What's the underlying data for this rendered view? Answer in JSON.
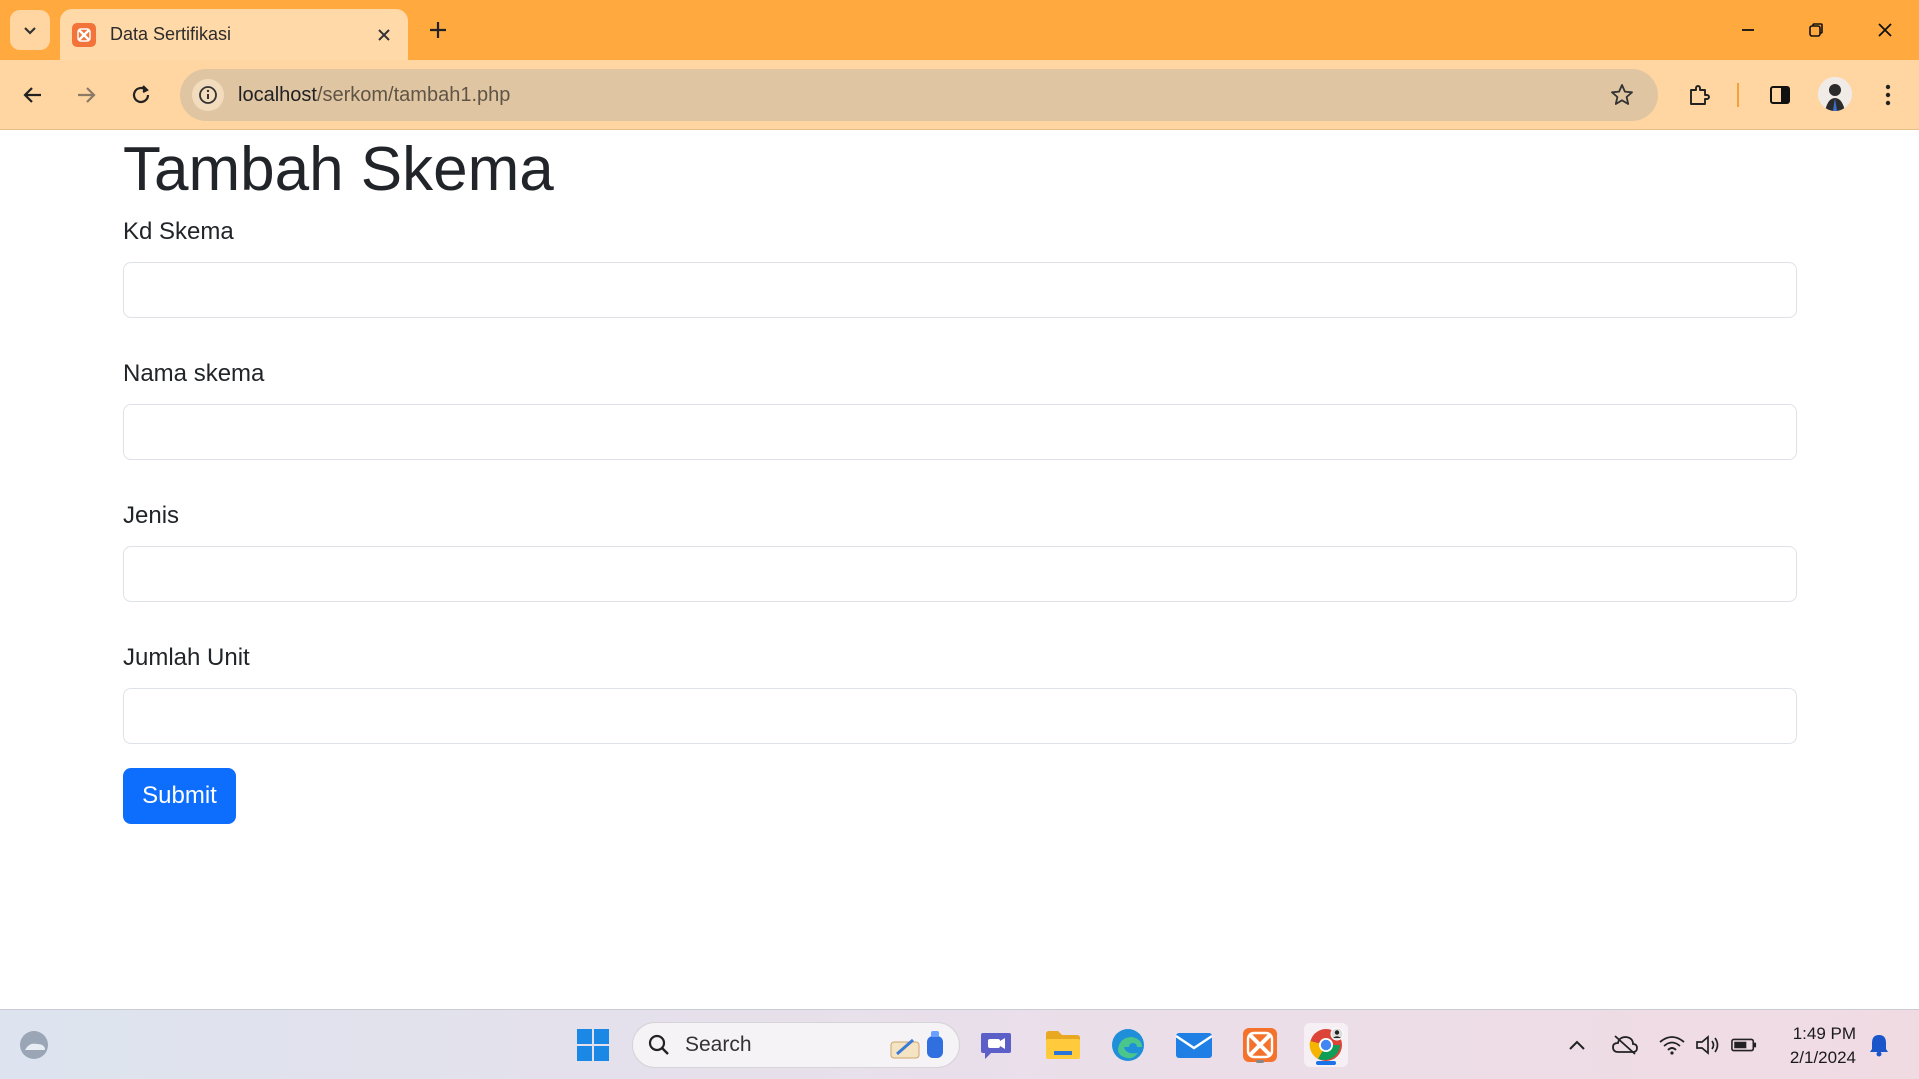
{
  "browser": {
    "tab_title": "Data Sertifikasi",
    "url_host": "localhost",
    "url_path": "/serkom/tambah1.php"
  },
  "page": {
    "title": "Tambah Skema",
    "fields": [
      {
        "label": "Kd Skema",
        "value": ""
      },
      {
        "label": "Nama skema",
        "value": ""
      },
      {
        "label": "Jenis",
        "value": ""
      },
      {
        "label": "Jumlah Unit",
        "value": ""
      }
    ],
    "submit_label": "Submit"
  },
  "taskbar": {
    "search_label": "Search",
    "time": "1:49 PM",
    "date": "2/1/2024"
  },
  "colors": {
    "chrome_tabbar": "#ffa93f",
    "chrome_toolbar": "#ffd6a1",
    "submit_button": "#0d6efd"
  }
}
